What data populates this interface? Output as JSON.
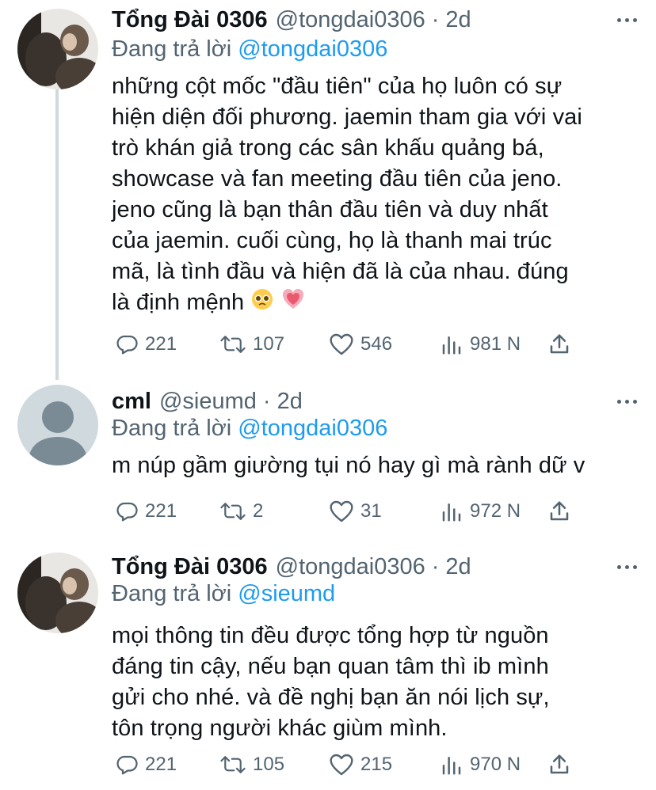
{
  "tweets": [
    {
      "name": "Tổng Đài 0306",
      "handle": "@tongdai0306",
      "dot": "·",
      "time": "2d",
      "replying_prefix": "Đang trả lời",
      "replying_to": "@tongdai0306",
      "text": "những cột mốc \"đầu tiên\" của họ luôn có sự\nhiện diện đối phương. jaemin tham gia với vai\ntrò khán giả trong các sân khấu quảng bá,\nshowcase và fan meeting đầu tiên của jeno.\njeno cũng là bạn thân đầu tiên và duy nhất\ncủa jaemin. cuối cùng, họ là thanh mai trúc\nmã, là tình đầu và hiện đã là của nhau. đúng\nlà định mệnh",
      "replies": "221",
      "retweets": "107",
      "likes": "546",
      "views": "981 N"
    },
    {
      "name": "cml",
      "handle": "@sieumd",
      "dot": "·",
      "time": "2d",
      "replying_prefix": "Đang trả lời",
      "replying_to": "@tongdai0306",
      "text": "m núp gầm giường tụi nó hay gì mà rành dữ v",
      "replies": "221",
      "retweets": "2",
      "likes": "31",
      "views": "972 N"
    },
    {
      "name": "Tổng Đài 0306",
      "handle": "@tongdai0306",
      "dot": "·",
      "time": "2d",
      "replying_prefix": "Đang trả lời",
      "replying_to": "@sieumd",
      "text": "mọi thông tin đều được tổng hợp từ nguồn\nđáng tin cậy, nếu bạn quan tâm thì ib mình\ngửi cho nhé. và đề nghị bạn ăn nói lịch sự,\ntôn trọng người khác giùm mình.",
      "replies": "221",
      "retweets": "105",
      "likes": "215",
      "views": "970 N"
    }
  ],
  "icons": {
    "reply": "reply-icon",
    "retweet": "retweet-icon",
    "like": "heart-icon",
    "views": "views-icon",
    "share": "share-icon",
    "more": "more-icon",
    "emoji_1": "pleading-face-emoji",
    "emoji_2": "growing-heart-emoji"
  },
  "colors": {
    "text": "#0f1419",
    "secondary": "#536471",
    "link": "#1d9bf0",
    "thread_line": "#cfd9de"
  }
}
